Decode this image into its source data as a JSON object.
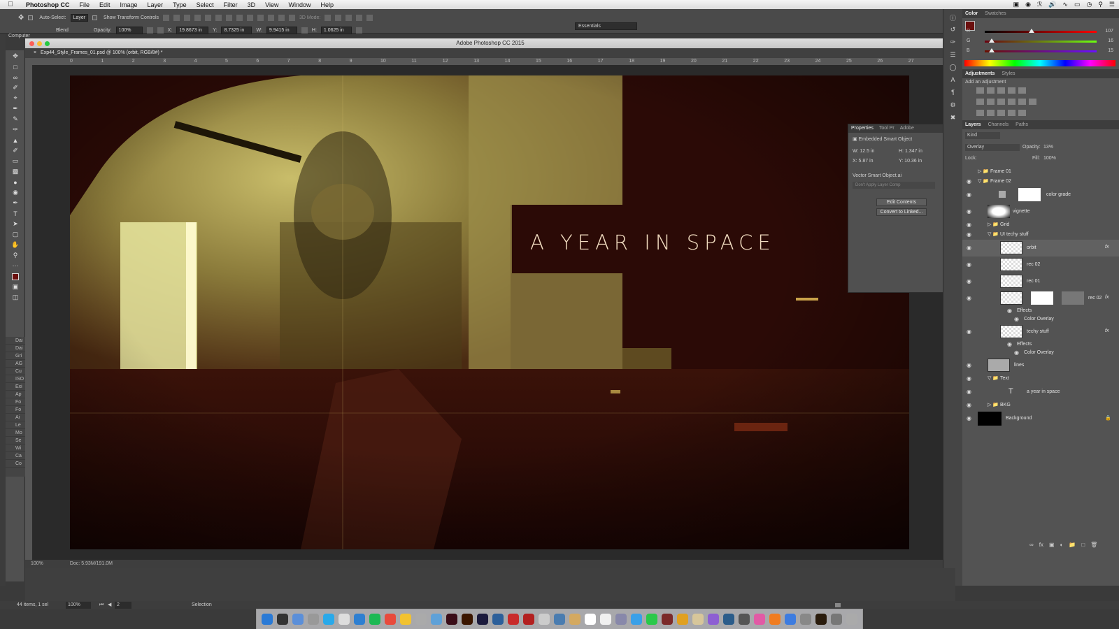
{
  "menubar": {
    "app_name": "Photoshop CC",
    "items": [
      "File",
      "Edit",
      "Image",
      "Layer",
      "Type",
      "Select",
      "Filter",
      "3D",
      "View",
      "Window",
      "Help"
    ]
  },
  "options": {
    "auto_select_label": "Auto-Select:",
    "auto_select_value": "Layer",
    "show_transform_label": "Show Transform Controls",
    "mode_3d_label": "3D Mode:",
    "workspace": "Essentials",
    "blend_label": "Blend",
    "opacity_label": "Opacity:",
    "opacity_value": "100%",
    "x_label": "X:",
    "x_value": "19.8673 in",
    "y_label": "Y:",
    "y_value": "8.7325 in",
    "w_label": "W:",
    "w_value": "9.9415 in",
    "h_label": "H:",
    "h_value": "1.0625 in",
    "computer_label": "Computer"
  },
  "document": {
    "window_title": "Adobe Photoshop CC 2015",
    "tab_title": "Exp44_Style_Frames_01.psd @ 100% (orbit, RGB/8#) *",
    "headline": "A YEAR IN SPACE",
    "zoom": "100%",
    "doc_size": "Doc: 5.93M/191.0M",
    "ruler_ticks": [
      "0",
      "1",
      "2",
      "3",
      "4",
      "5",
      "6",
      "7",
      "8",
      "9",
      "10",
      "11",
      "12",
      "13",
      "14",
      "15",
      "16",
      "17",
      "18",
      "19",
      "20",
      "21",
      "22",
      "23",
      "24",
      "25",
      "26",
      "27"
    ]
  },
  "properties": {
    "tabs": [
      "Properties",
      "Tool Pr",
      "Adobe"
    ],
    "title": "Embedded Smart Object",
    "w": "W:  12.5 in",
    "h": "H:  1.347 in",
    "x": "X:  5.87 in",
    "y": "Y:  10.36 in",
    "file": "Vector Smart Object.ai",
    "comp": "Don't Apply Layer Comp",
    "edit_button": "Edit Contents",
    "convert_button": "Convert to Linked..."
  },
  "color_panel": {
    "tabs": [
      "Color",
      "Swatches"
    ],
    "r_label": "R",
    "r": "107",
    "g_label": "G",
    "g": "16",
    "b_label": "B",
    "b": "15",
    "r_fraction": 0.42,
    "g_fraction": 0.06,
    "b_fraction": 0.06,
    "fg_color": "#6b100f"
  },
  "adjustments": {
    "tabs": [
      "Adjustments",
      "Styles"
    ],
    "hint": "Add an adjustment"
  },
  "layers_panel": {
    "tabs": [
      "Layers",
      "Channels",
      "Paths"
    ],
    "kind": "Kind",
    "blend_mode": "Overlay",
    "opacity_label": "Opacity:",
    "opacity": "13%",
    "lock_label": "Lock:",
    "fill_label": "Fill:",
    "fill": "100%",
    "layers": [
      {
        "name": "Frame 01"
      },
      {
        "name": "Frame 02"
      },
      {
        "name": "color grade"
      },
      {
        "name": "vignette"
      },
      {
        "name": "Grid"
      },
      {
        "name": "UI techy stuff"
      },
      {
        "name": "orbit"
      },
      {
        "name": "rec 02"
      },
      {
        "name": "rec 01"
      },
      {
        "name": "rec 02"
      },
      {
        "name": "Effects"
      },
      {
        "name": "Color Overlay"
      },
      {
        "name": "techy stuff"
      },
      {
        "name": "Effects"
      },
      {
        "name": "Color Overlay"
      },
      {
        "name": "lines"
      },
      {
        "name": "Text"
      },
      {
        "name": "a year in space"
      },
      {
        "name": "BKG"
      },
      {
        "name": "Background"
      }
    ]
  },
  "history_panel": {
    "items": [
      "Dai",
      "Dai",
      "Gri",
      "AG",
      "Cu",
      "ISO",
      "Exi",
      "Ap",
      "Fo",
      "Fo",
      "Ai",
      "Le",
      "Mo",
      "Se",
      "Wi",
      "Ca",
      "Co"
    ]
  },
  "status": {
    "items_count": "44 items, 1 sel",
    "zoom": "100%",
    "page": "2",
    "selection": "Selection"
  },
  "icons": [
    "apple-icon",
    "move-tool-icon",
    "marquee-tool-icon",
    "lasso-tool-icon",
    "crop-tool-icon",
    "eyedropper-icon",
    "brush-icon",
    "eraser-icon",
    "type-tool-icon",
    "hand-tool-icon",
    "zoom-tool-icon",
    "eye-icon",
    "lock-icon",
    "folder-icon",
    "trash-icon"
  ]
}
